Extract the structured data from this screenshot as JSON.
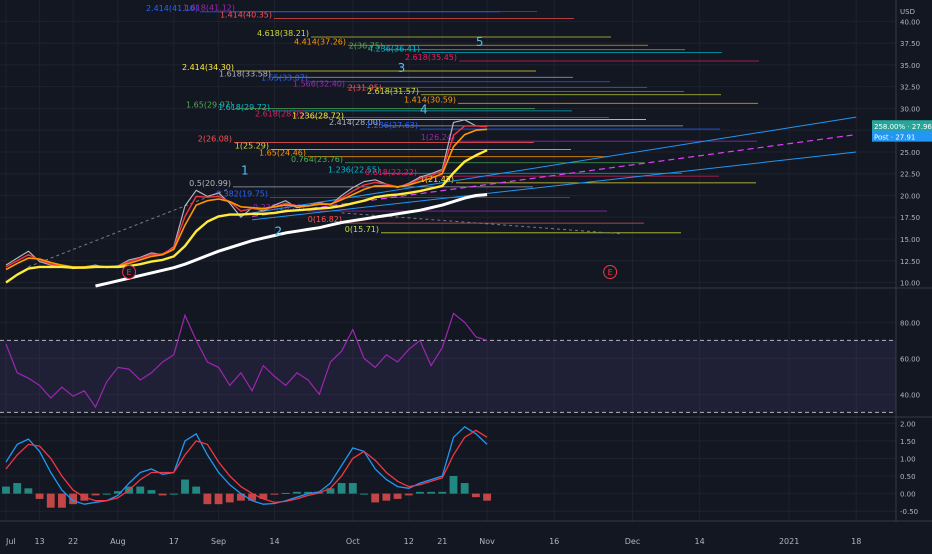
{
  "chart_data": {
    "type": "line",
    "title": "",
    "price_pane": {
      "currency": "USD",
      "y_ticks": [
        10.0,
        12.5,
        15.0,
        17.5,
        20.0,
        22.5,
        25.0,
        27.5,
        30.0,
        32.5,
        35.0,
        37.5,
        40.0
      ],
      "ylim": [
        9.6,
        42.0
      ],
      "last_price_label": "258.00% · 27.96",
      "post_price_label": "Post · 27.91",
      "last_price": 27.96,
      "post_price": 27.91,
      "series": [
        {
          "name": "",
          "color": "#b2b5be",
          "values": [
            12.0,
            12.8,
            13.6,
            12.4,
            12.0,
            11.9,
            11.6,
            11.8,
            12.0,
            11.7,
            11.9,
            12.6,
            12.9,
            13.4,
            13.2,
            14.1,
            18.8,
            20.6,
            19.9,
            20.3,
            19.1,
            17.5,
            18.6,
            18.2,
            18.9,
            19.4,
            18.6,
            18.8,
            19.2,
            18.9,
            20.0,
            20.9,
            21.6,
            21.8,
            21.3,
            20.9,
            21.4,
            22.1,
            22.5,
            23.0,
            28.4,
            28.7,
            28.0,
            27.96
          ]
        },
        {
          "name": "",
          "color": "#f23645",
          "values": [
            11.8,
            12.5,
            13.2,
            12.6,
            12.1,
            11.9,
            11.7,
            11.8,
            11.9,
            11.8,
            11.9,
            12.4,
            12.8,
            13.2,
            13.3,
            14.0,
            17.6,
            19.9,
            19.8,
            19.9,
            19.3,
            18.2,
            18.5,
            18.4,
            18.7,
            19.1,
            18.8,
            18.8,
            19.1,
            19.0,
            19.7,
            20.5,
            21.2,
            21.5,
            21.3,
            21.0,
            21.3,
            21.9,
            22.3,
            22.8,
            26.9,
            28.0,
            28.0,
            27.9
          ]
        },
        {
          "name": "",
          "color": "#ff9800",
          "values": [
            11.5,
            12.2,
            12.8,
            12.7,
            12.3,
            12.0,
            11.8,
            11.8,
            11.9,
            11.8,
            11.9,
            12.2,
            12.6,
            13.0,
            13.2,
            13.8,
            16.6,
            18.9,
            19.4,
            19.6,
            19.3,
            18.7,
            18.6,
            18.5,
            18.7,
            18.9,
            18.8,
            18.8,
            19.0,
            19.0,
            19.5,
            20.1,
            20.7,
            21.1,
            21.1,
            21.0,
            21.2,
            21.6,
            22.0,
            22.5,
            25.6,
            27.0,
            27.5,
            27.6
          ]
        },
        {
          "name": "",
          "color": "#ffeb3b",
          "values": [
            10.0,
            10.9,
            11.6,
            11.8,
            11.8,
            11.8,
            11.7,
            11.7,
            11.8,
            11.8,
            11.8,
            11.9,
            12.1,
            12.4,
            12.6,
            13.0,
            14.2,
            15.9,
            17.0,
            17.6,
            17.8,
            17.8,
            17.9,
            17.9,
            18.0,
            18.2,
            18.3,
            18.4,
            18.5,
            18.6,
            18.8,
            19.1,
            19.4,
            19.8,
            20.0,
            20.1,
            20.3,
            20.5,
            20.8,
            21.1,
            22.6,
            23.9,
            24.6,
            25.2
          ]
        },
        {
          "name": "",
          "color": "#ffffff",
          "values": [
            null,
            null,
            null,
            null,
            null,
            null,
            null,
            null,
            9.6,
            9.9,
            10.2,
            10.5,
            10.8,
            11.1,
            11.4,
            11.7,
            12.1,
            12.6,
            13.1,
            13.6,
            14.0,
            14.4,
            14.8,
            15.1,
            15.4,
            15.7,
            15.9,
            16.1,
            16.3,
            16.6,
            16.9,
            17.1,
            17.3,
            17.5,
            17.7,
            17.9,
            18.1,
            18.3,
            18.6,
            18.9,
            19.3,
            19.7,
            20.0,
            20.1
          ]
        }
      ],
      "fib_labels": [
        {
          "text": "2.414(41.10)",
          "value": 41.1
        },
        {
          "text": "1.618(41.12)",
          "value": 41.12
        },
        {
          "text": "1.414(40.35)",
          "value": 40.35
        },
        {
          "text": "4.618(38.21)",
          "value": 38.21
        },
        {
          "text": "4.414(37.26)",
          "value": 37.26
        },
        {
          "text": "2(36.75)",
          "value": 36.75
        },
        {
          "text": "4.236(36.41)",
          "value": 36.41
        },
        {
          "text": "2.618(35.45)",
          "value": 35.45
        },
        {
          "text": "2.414(34.30)",
          "value": 34.3
        },
        {
          "text": "1.618(33.58)",
          "value": 33.58
        },
        {
          "text": "1.65(33.07)",
          "value": 33.07
        },
        {
          "text": "1.566(32.40)",
          "value": 32.4
        },
        {
          "text": "2(31.95)",
          "value": 31.95
        },
        {
          "text": "2.618(31.57)",
          "value": 31.57
        },
        {
          "text": "1.414(30.59)",
          "value": 30.59
        },
        {
          "text": "1.65(29.97)",
          "value": 29.97
        },
        {
          "text": "1.618(29.72)",
          "value": 29.72
        },
        {
          "text": "2.618(28.95)",
          "value": 28.95
        },
        {
          "text": "1.236(28.72)",
          "value": 28.72
        },
        {
          "text": "2.414(28.00)",
          "value": 28.0
        },
        {
          "text": "1.236(27.63)",
          "value": 27.63
        },
        {
          "text": "1(26.24)",
          "value": 26.24
        },
        {
          "text": "2(26.08)",
          "value": 26.08
        },
        {
          "text": "1(25.29)",
          "value": 25.29
        },
        {
          "text": "1.65(24.46)",
          "value": 24.46
        },
        {
          "text": "0.764(23.76)",
          "value": 23.76
        },
        {
          "text": "1.236(22.55)",
          "value": 22.55
        },
        {
          "text": "0.618(22.22)",
          "value": 22.22
        },
        {
          "text": "1(21.45)",
          "value": 21.45
        },
        {
          "text": "0.5(20.99)",
          "value": 20.99
        },
        {
          "text": "0.382(19.75)",
          "value": 19.75
        },
        {
          "text": "0.236(18.21)",
          "value": 18.21
        },
        {
          "text": "0(16.82)",
          "value": 16.82
        },
        {
          "text": "0(15.71)",
          "value": 15.71
        }
      ],
      "wave_labels": [
        {
          "text": "1",
          "x_index": 21,
          "value": 22.4
        },
        {
          "text": "2",
          "x_index": 24,
          "value": 15.4
        },
        {
          "text": "3",
          "x_index": 35,
          "value": 34.2
        },
        {
          "text": "4",
          "x_index": 37,
          "value": 29.4
        },
        {
          "text": "5",
          "x_index": 42,
          "value": 37.2
        }
      ],
      "earnings_markers": [
        {
          "text": "E",
          "x_index": 11
        },
        {
          "text": "E",
          "x_index": 54
        }
      ]
    },
    "rsi_pane": {
      "y_ticks": [
        40.0,
        60.0,
        80.0
      ],
      "ylim": [
        28,
        98
      ],
      "bands": [
        70,
        30
      ],
      "values": [
        68,
        52,
        49,
        45,
        38,
        44,
        39,
        42,
        33,
        47,
        55,
        54,
        48,
        52,
        58,
        62,
        84,
        70,
        58,
        55,
        45,
        52,
        42,
        56,
        50,
        45,
        52,
        48,
        40,
        58,
        64,
        76,
        60,
        55,
        62,
        58,
        65,
        70,
        56,
        66,
        85,
        80,
        72,
        70
      ]
    },
    "macd_pane": {
      "y_ticks": [
        -0.5,
        0.0,
        0.5,
        1.0,
        1.5,
        2.0
      ],
      "ylim": [
        -0.75,
        2.15
      ],
      "macd": [
        0.9,
        1.4,
        1.55,
        1.2,
        0.6,
        0.1,
        -0.2,
        -0.3,
        -0.25,
        -0.2,
        -0.05,
        0.3,
        0.6,
        0.7,
        0.55,
        0.6,
        1.5,
        1.7,
        1.1,
        0.6,
        0.25,
        0.0,
        -0.2,
        -0.3,
        -0.28,
        -0.2,
        -0.1,
        0.0,
        0.05,
        0.3,
        0.8,
        1.3,
        1.2,
        0.7,
        0.4,
        0.2,
        0.15,
        0.3,
        0.4,
        0.5,
        1.6,
        1.9,
        1.7,
        1.4
      ],
      "signal": [
        0.7,
        1.1,
        1.4,
        1.35,
        1.0,
        0.5,
        0.1,
        -0.1,
        -0.2,
        -0.2,
        -0.12,
        0.1,
        0.4,
        0.6,
        0.6,
        0.6,
        1.1,
        1.5,
        1.4,
        0.9,
        0.5,
        0.2,
        0.0,
        -0.15,
        -0.25,
        -0.22,
        -0.15,
        -0.05,
        0.02,
        0.15,
        0.5,
        1.0,
        1.2,
        0.95,
        0.6,
        0.35,
        0.2,
        0.25,
        0.35,
        0.45,
        1.1,
        1.6,
        1.8,
        1.6
      ],
      "histogram": [
        0.2,
        0.3,
        0.15,
        -0.15,
        -0.4,
        -0.4,
        -0.3,
        -0.2,
        -0.05,
        0.0,
        0.07,
        0.2,
        0.2,
        0.1,
        -0.05,
        0.0,
        0.4,
        0.2,
        -0.3,
        -0.3,
        -0.25,
        -0.2,
        -0.2,
        -0.15,
        -0.03,
        0.02,
        0.05,
        0.05,
        0.03,
        0.15,
        0.3,
        0.3,
        0.0,
        -0.25,
        -0.2,
        -0.15,
        -0.05,
        0.05,
        0.05,
        0.05,
        0.5,
        0.3,
        -0.1,
        -0.2
      ]
    },
    "x_axis": {
      "tick_labels": [
        "Jul",
        "13",
        "22",
        "Aug",
        "17",
        "Sep",
        "14",
        "Oct",
        "12",
        "21",
        "Nov",
        "16",
        "Dec",
        "14",
        "2021",
        "18"
      ],
      "tick_index": [
        0,
        3,
        6,
        10,
        15,
        19,
        24,
        31,
        36,
        39,
        43,
        49,
        56,
        62,
        70,
        76
      ]
    },
    "grid": true,
    "legend": "none"
  }
}
